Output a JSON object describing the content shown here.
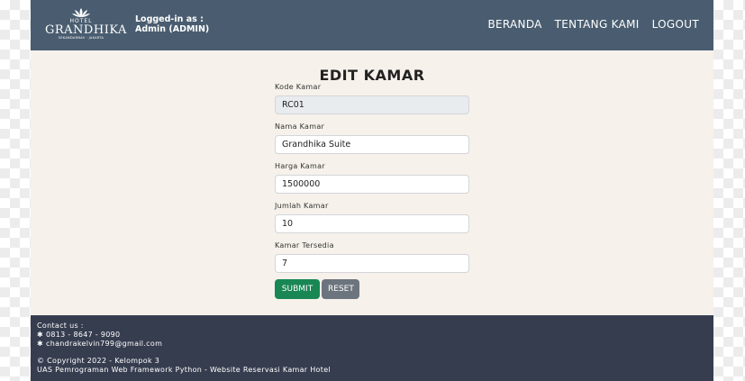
{
  "brand": {
    "small_top": "HOTEL",
    "name": "GRANDHIKA",
    "subtitle": "SEKANDARNAV · JAKARTA"
  },
  "user": {
    "line1": "Logged-in as :",
    "line2": "Admin (ADMIN)"
  },
  "nav": {
    "home": "BERANDA",
    "about": "TENTANG KAMI",
    "logout": "LOGOUT"
  },
  "page": {
    "title": "EDIT KAMAR"
  },
  "form": {
    "fields": [
      {
        "label": "Kode Kamar",
        "value": "RC01",
        "disabled": true
      },
      {
        "label": "Nama Kamar",
        "value": "Grandhika Suite",
        "disabled": false
      },
      {
        "label": "Harga Kamar",
        "value": "1500000",
        "disabled": false
      },
      {
        "label": "Jumlah Kamar",
        "value": "10",
        "disabled": false
      },
      {
        "label": "Kamar Tersedia",
        "value": "7",
        "disabled": false
      }
    ],
    "submit_label": "SUBMIT",
    "reset_label": "RESET"
  },
  "footer": {
    "contact_heading": "Contact us :",
    "phone": "0813 - 8647 - 9090",
    "email": "chandrakelvin799@gmail.com",
    "copyright": "© Copyright 2022 - Kelompok 3",
    "course": "UAS Pemrograman Web Framework Python - Website Reservasi Kamar Hotel",
    "bullet_icon": "asterisk-icon"
  },
  "colors": {
    "navbar": "#4a5d70",
    "content_bg": "#f6f1ea",
    "footer": "#363d4f",
    "submit": "#198754",
    "reset": "#6c757d"
  }
}
